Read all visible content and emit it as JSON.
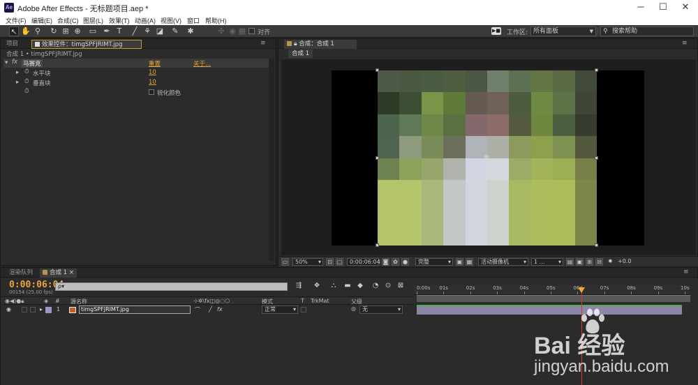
{
  "window": {
    "logo": "Ae",
    "title": "Adobe After Effects - 无标题项目.aep *",
    "controls": {
      "minimize": "─",
      "maximize": "☐",
      "close": "✕"
    }
  },
  "menu": [
    "文件(F)",
    "编辑(E)",
    "合成(C)",
    "图层(L)",
    "效果(T)",
    "动画(A)",
    "视图(V)",
    "窗口",
    "帮助(H)"
  ],
  "toolbar": {
    "snap_label": "对齐",
    "workspace_icon": "▶■",
    "workspace_label": "工作区:",
    "workspace_value": "所有面板",
    "help_placeholder": "搜索帮助",
    "help_icon": "search-icon"
  },
  "effect_panel": {
    "tab_project": "项目",
    "tab_effect": "效果控件：timgSPFJRIMT.jpg",
    "subtitle": "合成 1 • timgSPFJRIMT.jpg",
    "effect_name": "马赛克",
    "reset": "重置",
    "about": "关于...",
    "fx_badge": "fx",
    "props": [
      {
        "name": "水平块",
        "value": "10"
      },
      {
        "name": "垂直块",
        "value": "10"
      },
      {
        "name": "",
        "value": "锐化颜色"
      }
    ]
  },
  "comp_panel": {
    "tab": "合成：合成 1",
    "comp_name": "合成 1",
    "zoom": "50%",
    "timecode": "0:00:06:04",
    "resolution": "完整",
    "camera": "活动摄像机",
    "views": "1 ...",
    "exposure": "+0.0"
  },
  "mosaic_colors": [
    [
      "#4d5a47",
      "#49583f",
      "#4c5c42",
      "#4f5d41",
      "#4b5742",
      "#71806a",
      "#5c7151",
      "#637545",
      "#5a6a44",
      "#424a3b"
    ],
    [
      "#2e3a25",
      "#3e4e34",
      "#7a9448",
      "#5e7a36",
      "#645a51",
      "#6f6155",
      "#4c5c3d",
      "#6e8a44",
      "#5e7247",
      "#3f4637"
    ],
    [
      "#4c644c",
      "#5f7856",
      "#6e8848",
      "#5a7040",
      "#84686c",
      "#8d6c68",
      "#555a3e",
      "#70883e",
      "#4e5e40",
      "#363d30"
    ],
    [
      "#4f6351",
      "#8e9c7d",
      "#7a8b5a",
      "#6c6f5a",
      "#b0b4b8",
      "#aeb0a7",
      "#8d9a5d",
      "#8fa04d",
      "#7f9150",
      "#53593f"
    ],
    [
      "#6e8252",
      "#8fa25c",
      "#97a76c",
      "#b0b4ad",
      "#d2d6e3",
      "#d4d8df",
      "#9cab66",
      "#a3b45a",
      "#9daf55",
      "#787e48"
    ],
    [
      "#b3c46a",
      "#b5c56b",
      "#a8b77a",
      "#c3c8c7",
      "#d0d5de",
      "#ccd3cb",
      "#a8ba61",
      "#aebe5c",
      "#abbc58",
      "#7e8548"
    ],
    [
      "#b3c46a",
      "#b5c56b",
      "#a8b77a",
      "#c3c8c7",
      "#d0d5de",
      "#ccd3cb",
      "#a8ba61",
      "#aebe5c",
      "#abbc58",
      "#7e8548"
    ],
    [
      "#b3c46a",
      "#b5c56b",
      "#a8b77a",
      "#c3c8c7",
      "#d0d5de",
      "#ccd3cb",
      "#a8ba61",
      "#aebe5c",
      "#abbc58",
      "#7e8548"
    ]
  ],
  "timeline": {
    "tab_render": "渲染队列",
    "tab_comp": "合成 1",
    "timecode": "0:00:06:04",
    "fps": "00154 (25.00 fps)",
    "search_placeholder": "ρ▾",
    "headers": {
      "hash": "#",
      "source": "源名称",
      "mode": "模式",
      "t": "T",
      "trkmat": "TrkMat",
      "parent": "父级"
    },
    "layer": {
      "index": "1",
      "name": "timgSPFJRIMT.jpg",
      "mode": "正常",
      "parent": "无",
      "fx": "fx"
    },
    "ruler": [
      "0:00s",
      "01s",
      "02s",
      "03s",
      "04s",
      "05s",
      "06s",
      "07s",
      "08s",
      "09s",
      "10s"
    ],
    "current_time_fraction": 0.615
  },
  "watermark": {
    "brand": "Bai  经验",
    "url": "jingyan.baidu.com"
  }
}
